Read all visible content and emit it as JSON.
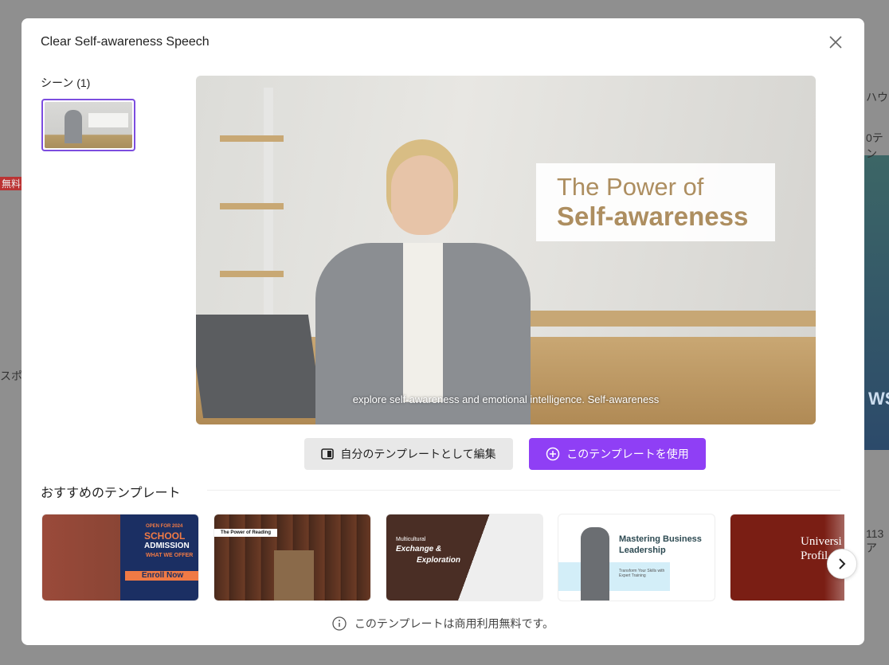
{
  "background": {
    "left_badge": "無料",
    "left_text": "スポ",
    "right_texts": [
      "ハウ",
      "0テン",
      "113ア"
    ],
    "right_image_text": "WS"
  },
  "modal": {
    "title": "Clear Self-awareness Speech",
    "scenes_label": "シーン (1)",
    "preview": {
      "headline_line1": "The Power of",
      "headline_line2": "Self-awareness",
      "caption": "explore self-awareness and emotional intelligence. Self-awareness"
    },
    "buttons": {
      "edit": "自分のテンプレートとして編集",
      "use": "このテンプレートを使用"
    },
    "accent_color": "#8f3ff5",
    "recommended_title": "おすすめのテンプレート",
    "templates": [
      {
        "line1": "OPEN FOR 2024",
        "line2": "SCHOOL",
        "line3": "ADMISSION",
        "line4": "WHAT WE OFFER",
        "cta": "Enroll Now"
      },
      {
        "line1": "The Power of Reading"
      },
      {
        "line1": "Multicultural",
        "line2": "Exchange &",
        "line3": "Exploration"
      },
      {
        "line1": "Mastering Business",
        "line2": "Leadership",
        "line3": "Transform Your Skills with Expert Training"
      },
      {
        "line1": "Universi",
        "line2": "Profil"
      }
    ],
    "note": "このテンプレートは商用利用無料です。"
  }
}
